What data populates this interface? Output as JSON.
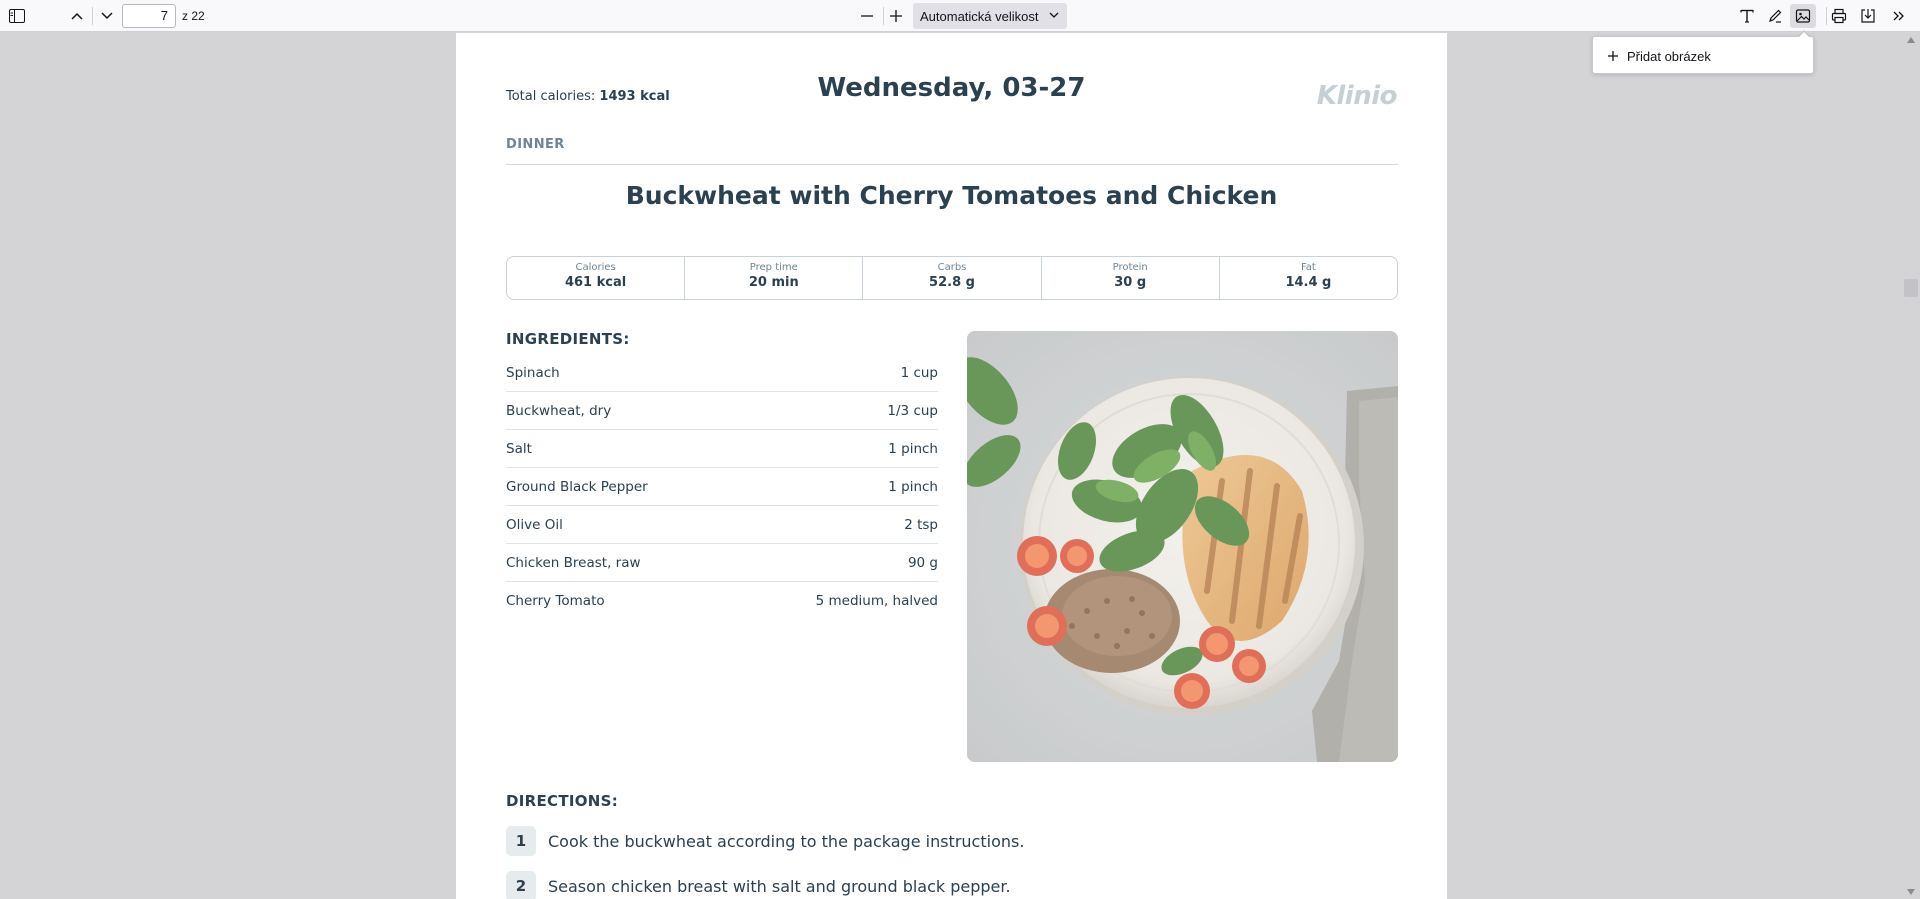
{
  "toolbar": {
    "sidebar_toggle_icon": "sidebar-icon",
    "prev_icon": "chevron-up-icon",
    "next_icon": "chevron-down-icon",
    "page_number": "7",
    "page_count": "z 22",
    "zoom_value": "Automatická velikost",
    "tools": [
      "text-icon",
      "draw-icon",
      "image-icon",
      "print-icon",
      "download-icon",
      "more-tools-icon"
    ]
  },
  "popup": {
    "add_image_label": "Přidat obrázek"
  },
  "document": {
    "total_calories_label": "Total calories: ",
    "total_calories_value": "1493 kcal",
    "day_title": "Wednesday, 03-27",
    "logo": "Klinio",
    "meal_type": "DINNER",
    "recipe_title": "Buckwheat with Cherry Tomatoes and Chicken",
    "stats": [
      {
        "label": "Calories",
        "value": "461 kcal"
      },
      {
        "label": "Prep time",
        "value": "20 min"
      },
      {
        "label": "Carbs",
        "value": "52.8 g"
      },
      {
        "label": "Protein",
        "value": "30 g"
      },
      {
        "label": "Fat",
        "value": "14.4 g"
      }
    ],
    "ingredients_heading": "INGREDIENTS:",
    "ingredients": [
      {
        "name": "Spinach",
        "amount": "1 cup"
      },
      {
        "name": "Buckwheat, dry",
        "amount": "1/3 cup"
      },
      {
        "name": "Salt",
        "amount": "1 pinch"
      },
      {
        "name": "Ground Black Pepper",
        "amount": "1 pinch"
      },
      {
        "name": "Olive Oil",
        "amount": "2 tsp"
      },
      {
        "name": "Chicken Breast, raw",
        "amount": "90 g"
      },
      {
        "name": "Cherry Tomato",
        "amount": "5 medium, halved"
      }
    ],
    "directions_heading": "DIRECTIONS:",
    "directions": [
      {
        "num": "1",
        "text": "Cook the buckwheat according to the package instructions."
      },
      {
        "num": "2",
        "text": "Season chicken breast with salt and ground black pepper."
      }
    ]
  }
}
